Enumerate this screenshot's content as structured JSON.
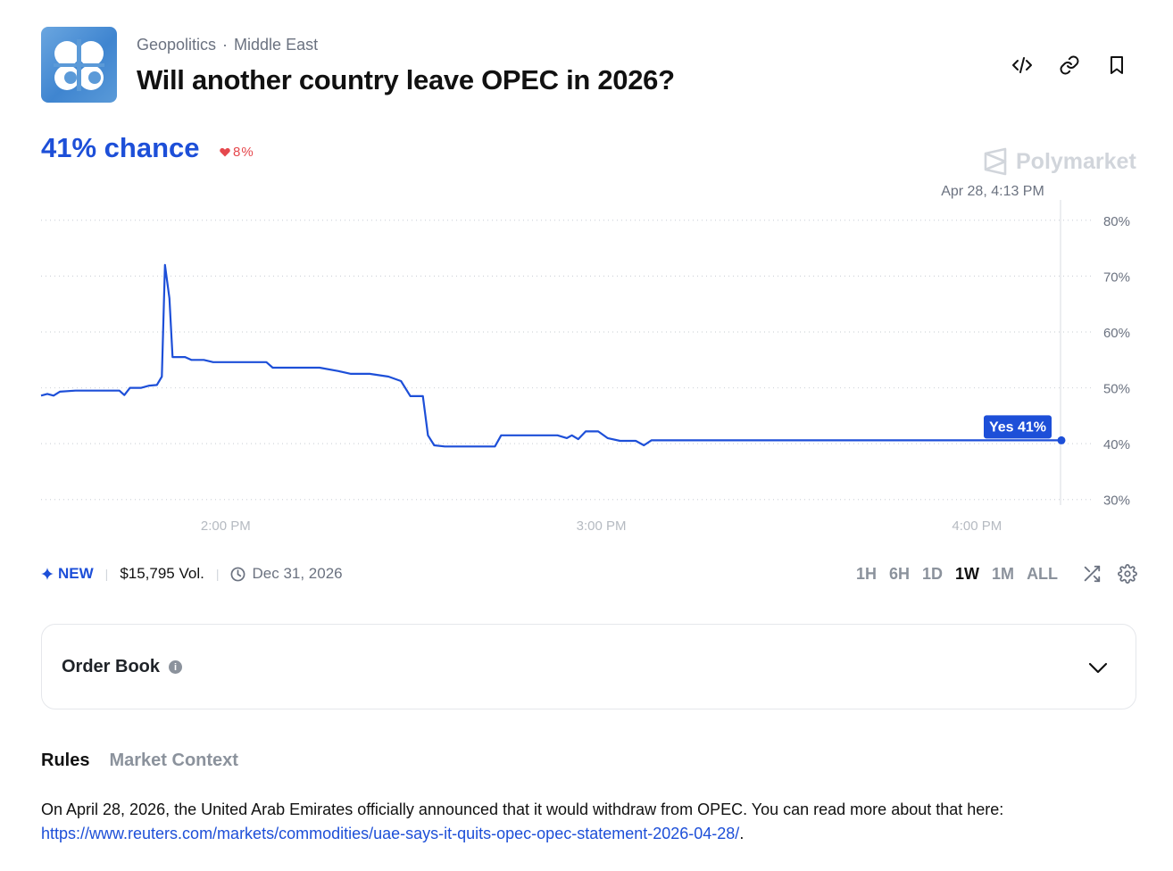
{
  "header": {
    "logo_icon": "opec-logo-icon",
    "category": "Geopolitics",
    "subcategory": "Middle East",
    "title": "Will another country leave OPEC in 2026?",
    "actions": [
      "embed-code-icon",
      "link-icon",
      "bookmark-icon"
    ]
  },
  "summary": {
    "chance_text": "41% chance",
    "delta_text": "8%",
    "delta_direction": "down"
  },
  "brand": {
    "name": "Polymarket"
  },
  "chart_data": {
    "type": "line",
    "hover_label": "Apr 28, 4:13 PM",
    "y_ticks": [
      "80%",
      "70%",
      "60%",
      "50%",
      "40%",
      "30%"
    ],
    "y_tick_values": [
      80,
      70,
      60,
      50,
      40,
      30
    ],
    "ylim": [
      29,
      83
    ],
    "x_ticks": [
      "2:00 PM",
      "3:00 PM",
      "4:00 PM"
    ],
    "x_tick_minutes": [
      0,
      60,
      120
    ],
    "xlim_minutes": [
      -29.5,
      133.5
    ],
    "grid": true,
    "series": [
      {
        "name": "Yes",
        "color": "#1d4fd8",
        "end_label": "Yes 41%",
        "points": [
          [
            -29.5,
            48.6
          ],
          [
            -28.5,
            48.9
          ],
          [
            -27.5,
            48.6
          ],
          [
            -26.5,
            49.3
          ],
          [
            -24,
            49.5
          ],
          [
            -20.5,
            49.5
          ],
          [
            -17,
            49.5
          ],
          [
            -16.2,
            48.7
          ],
          [
            -15.3,
            50.0
          ],
          [
            -13.5,
            50.0
          ],
          [
            -12.2,
            50.4
          ],
          [
            -11,
            50.5
          ],
          [
            -10.2,
            52
          ],
          [
            -9.7,
            72.0
          ],
          [
            -9.0,
            66
          ],
          [
            -8.5,
            55.5
          ],
          [
            -6.5,
            55.5
          ],
          [
            -5.5,
            55.0
          ],
          [
            -3.5,
            55.0
          ],
          [
            -2,
            54.6
          ],
          [
            1,
            54.6
          ],
          [
            6.5,
            54.6
          ],
          [
            7.5,
            53.6
          ],
          [
            15,
            53.6
          ],
          [
            18,
            53.0
          ],
          [
            20,
            52.5
          ],
          [
            23,
            52.5
          ],
          [
            26,
            52.0
          ],
          [
            28,
            51.2
          ],
          [
            29.5,
            48.5
          ],
          [
            31.5,
            48.5
          ],
          [
            32.3,
            41.5
          ],
          [
            33.3,
            39.7
          ],
          [
            35,
            39.5
          ],
          [
            43,
            39.5
          ],
          [
            44,
            41.5
          ],
          [
            49,
            41.5
          ],
          [
            53,
            41.5
          ],
          [
            54.5,
            41.0
          ],
          [
            55.3,
            41.5
          ],
          [
            56.3,
            40.8
          ],
          [
            57.5,
            42.2
          ],
          [
            59.5,
            42.2
          ],
          [
            61,
            41.0
          ],
          [
            63,
            40.5
          ],
          [
            65.5,
            40.5
          ],
          [
            66.8,
            39.7
          ],
          [
            68,
            40.6
          ],
          [
            90,
            40.6
          ],
          [
            120,
            40.6
          ],
          [
            133.5,
            40.6
          ]
        ]
      }
    ]
  },
  "meta": {
    "new_label": "NEW",
    "volume": "$15,795 Vol.",
    "end_date": "Dec 31, 2026"
  },
  "ranges": [
    "1H",
    "6H",
    "1D",
    "1W",
    "1M",
    "ALL"
  ],
  "active_range": "1W",
  "order_book": {
    "title": "Order Book"
  },
  "tabs": [
    {
      "label": "Rules",
      "active": true
    },
    {
      "label": "Market Context",
      "active": false
    }
  ],
  "rules": {
    "text": "On April 28, 2026, the United Arab Emirates officially announced that it would withdraw from OPEC. You can read more about that here: ",
    "link": "https://www.reuters.com/markets/commodities/uae-says-it-quits-opec-opec-statement-2026-04-28/",
    "trailing": "."
  }
}
